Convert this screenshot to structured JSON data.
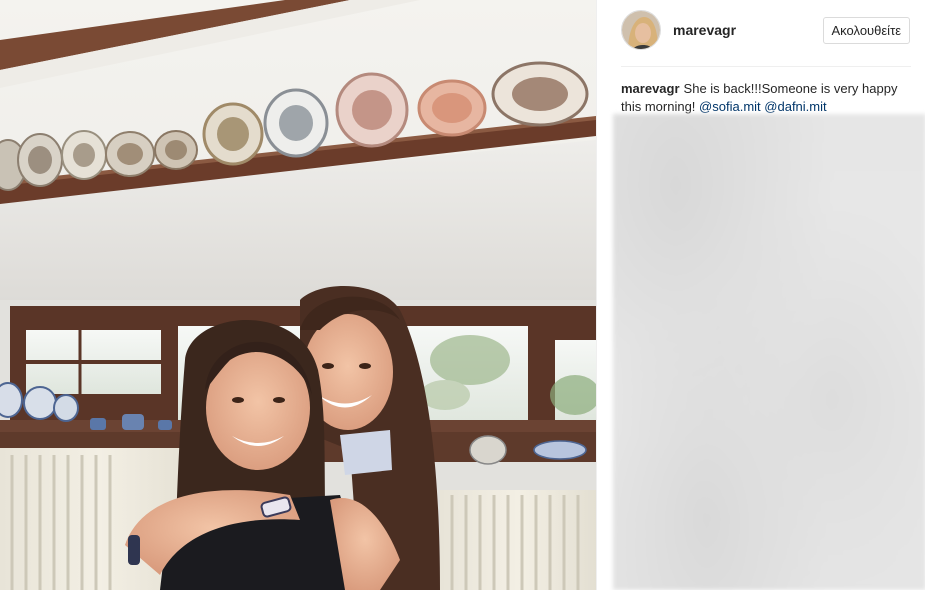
{
  "post": {
    "username": "marevagr",
    "follow_label": "Ακολουθείτε",
    "caption": {
      "username": "marevagr",
      "text": "She is back!!!Someone is very happy this morning!",
      "mentions": [
        "@sofia.mit",
        "@dafni.mit"
      ]
    }
  },
  "colors": {
    "mention": "#003569",
    "text": "#262626",
    "border": "#dbdbdb"
  },
  "icons": {
    "avatar": "profile-avatar",
    "photo": "post-photo"
  }
}
